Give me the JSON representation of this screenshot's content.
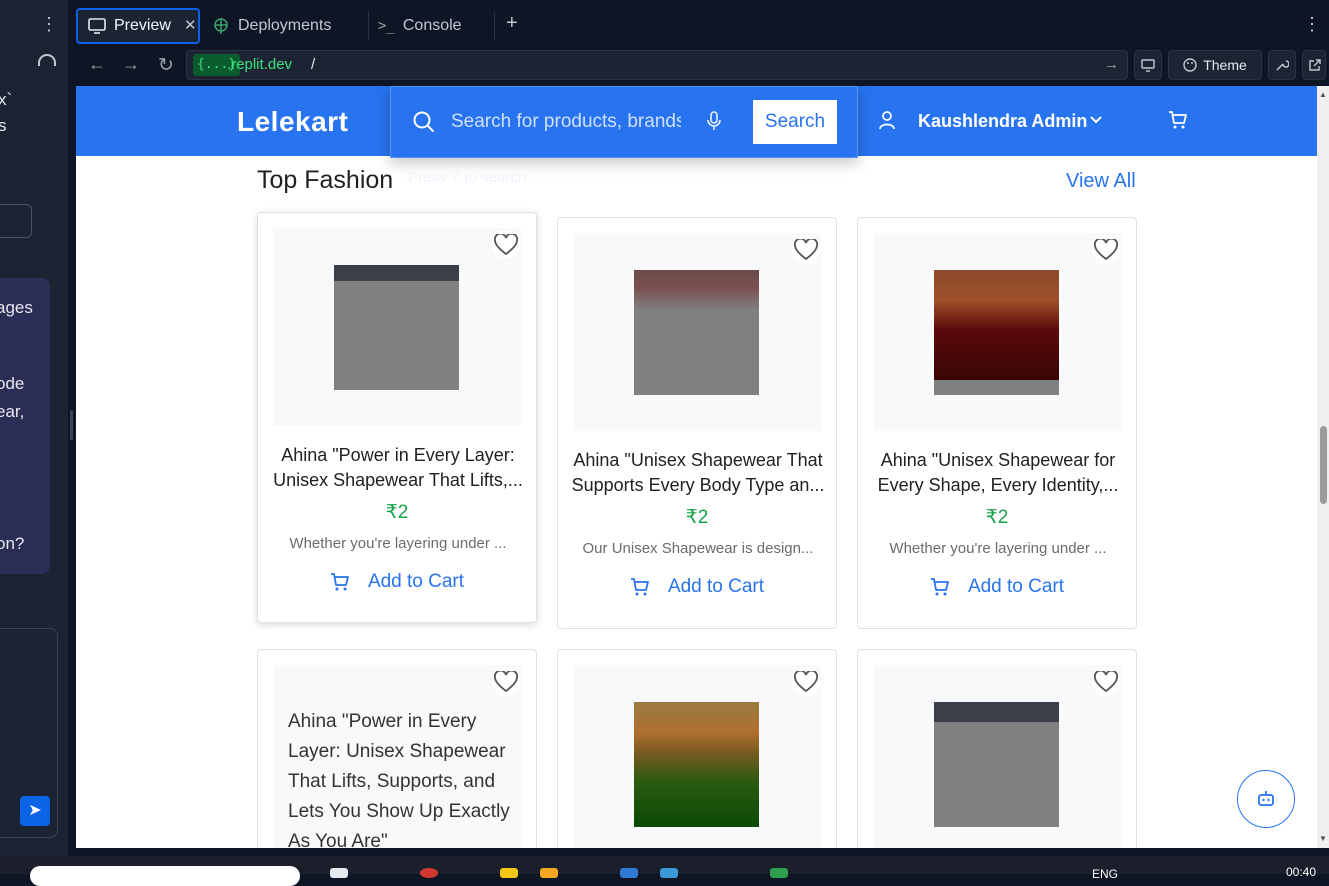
{
  "left_pane": {
    "fragments": [
      "x`",
      "s",
      "ages",
      "ode",
      "ear,",
      "on?"
    ]
  },
  "tabs": [
    {
      "label": "Preview",
      "icon": "monitor-icon"
    },
    {
      "label": "Deployments",
      "icon": "deployments-icon"
    },
    {
      "label": "Console",
      "icon": "terminal-icon"
    }
  ],
  "urlbar": {
    "badge": "{...}",
    "host": ".replit.dev",
    "path": "/",
    "theme_label": "Theme"
  },
  "app": {
    "logo": "Lelekart",
    "search_placeholder": "Search for products, brands and more",
    "search_button": "Search",
    "ghost_text": "Press '/' to search",
    "user_name": "Kaushlendra Admin",
    "section_title": "Top Fashion",
    "view_all": "View All",
    "colors": {
      "brand": "#2874f0",
      "price": "#16a34a"
    }
  },
  "products": [
    {
      "name_line1": "Ahina \"Power in Every Layer:",
      "name_line2": "Unisex Shapewear That Lifts,...",
      "price": "₹2",
      "desc": "Whether you're layering under ...",
      "add_label": "Add to Cart"
    },
    {
      "name_line1": "Ahina \"Unisex Shapewear That",
      "name_line2": "Supports Every Body Type an...",
      "price": "₹2",
      "desc": "Our Unisex Shapewear is design...",
      "add_label": "Add to Cart"
    },
    {
      "name_line1": "Ahina \"Unisex Shapewear for",
      "name_line2": "Every Shape, Every Identity,...",
      "price": "₹2",
      "desc": "Whether you're layering under ...",
      "add_label": "Add to Cart"
    },
    {
      "alt_text": "Ahina \"Power in Every Layer: Unisex Shapewear That Lifts, Supports, and Lets You Show Up Exactly As You Are\""
    },
    {},
    {}
  ],
  "taskbar": {
    "lang": "ENG",
    "time": "00:40"
  }
}
